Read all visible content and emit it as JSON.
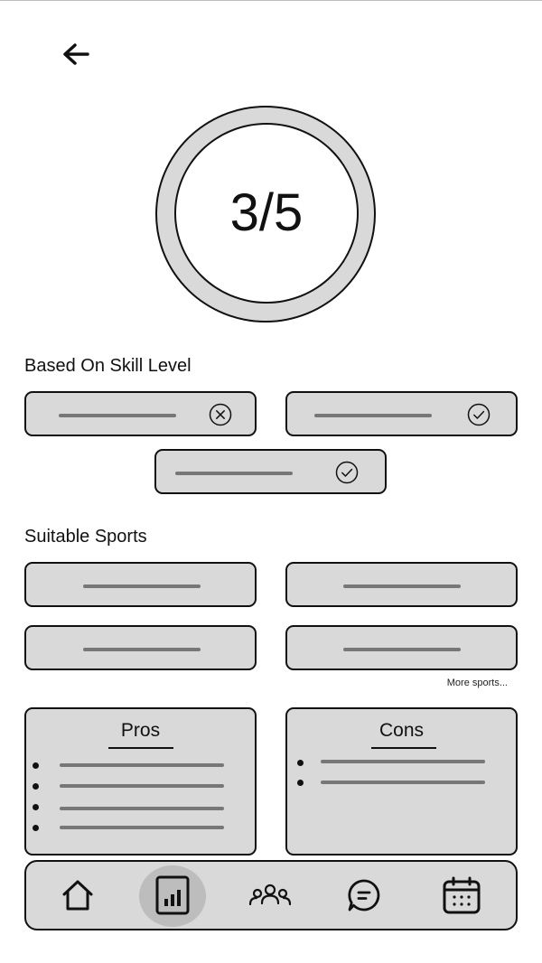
{
  "header": {
    "back_icon": "arrow-left-icon"
  },
  "score": {
    "text": "3/5",
    "fraction": 0.6
  },
  "skill": {
    "title": "Based On Skill Level",
    "items": [
      {
        "status_icon": "x-circle-icon"
      },
      {
        "status_icon": "check-circle-icon"
      },
      {
        "status_icon": "check-circle-icon"
      }
    ]
  },
  "sports": {
    "title": "Suitable Sports",
    "more_label": "More sports..."
  },
  "pros": {
    "title": "Pros"
  },
  "cons": {
    "title": "Cons"
  },
  "nav": {
    "items": [
      "home-icon",
      "stats-icon",
      "community-icon",
      "chat-icon",
      "calendar-icon"
    ],
    "active": "stats-icon"
  }
}
